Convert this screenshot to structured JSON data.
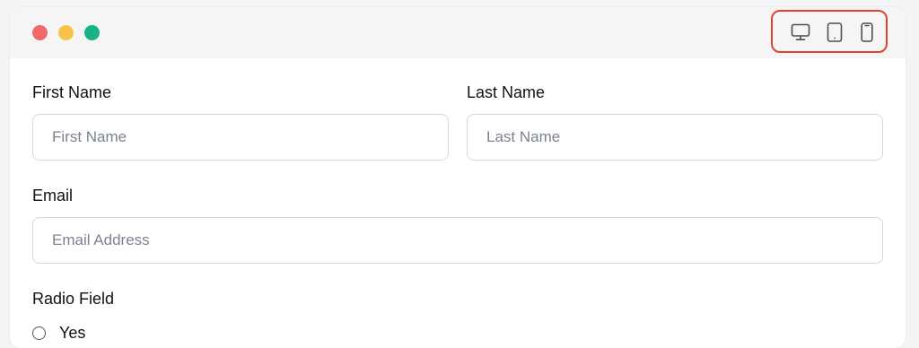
{
  "window": {
    "controls": [
      {
        "name": "close",
        "color": "#ee6a6a"
      },
      {
        "name": "minimize",
        "color": "#f7c24a"
      },
      {
        "name": "zoom",
        "color": "#17b387"
      }
    ],
    "device_switcher": {
      "highlight_color": "#e0412b",
      "icons": [
        "desktop-icon",
        "tablet-icon",
        "mobile-icon"
      ]
    }
  },
  "form": {
    "first_name": {
      "label": "First Name",
      "placeholder": "First Name",
      "value": ""
    },
    "last_name": {
      "label": "Last Name",
      "placeholder": "Last Name",
      "value": ""
    },
    "email": {
      "label": "Email",
      "placeholder": "Email Address",
      "value": ""
    },
    "radio_field": {
      "label": "Radio Field",
      "options": [
        "Yes"
      ]
    }
  }
}
